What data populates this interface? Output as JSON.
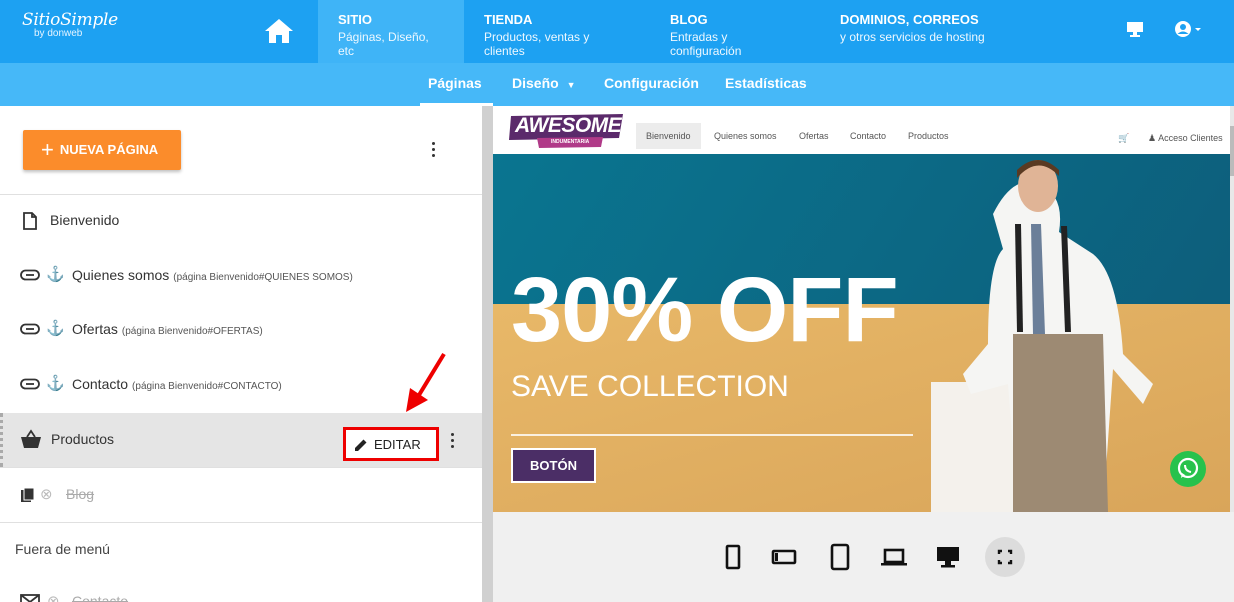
{
  "brand": {
    "name": "SitioSimple",
    "by": "by donweb"
  },
  "topnav": [
    {
      "title": "SITIO",
      "subtitle": "Páginas, Diseño, etc"
    },
    {
      "title": "TIENDA",
      "subtitle": "Productos, ventas y clientes"
    },
    {
      "title": "BLOG",
      "subtitle": "Entradas y configuración"
    },
    {
      "title": "DOMINIOS, CORREOS",
      "subtitle": "y otros servicios de hosting"
    }
  ],
  "subnav": [
    "Páginas",
    "Diseño",
    "Configuración",
    "Estadísticas"
  ],
  "left": {
    "new_page_label": "NUEVA PÁGINA",
    "pages": [
      {
        "label": "Bienvenido",
        "hint": ""
      },
      {
        "label": "Quienes somos",
        "hint": "(página Bienvenido#QUIENES SOMOS)"
      },
      {
        "label": "Ofertas",
        "hint": "(página Bienvenido#OFERTAS)"
      },
      {
        "label": "Contacto",
        "hint": "(página Bienvenido#CONTACTO)"
      },
      {
        "label": "Productos",
        "hint": ""
      },
      {
        "label": "Blog",
        "hint": ""
      }
    ],
    "edit_label": "EDITAR",
    "section_out_of_menu": "Fuera de menú",
    "hidden_contact": "Contacto"
  },
  "preview": {
    "logo_text": "AWESOME",
    "logo_sub": "INDUMENTARIA",
    "menu": [
      "Bienvenido",
      "Quienes somos",
      "Ofertas",
      "Contacto",
      "Productos"
    ],
    "client_access": "Acceso Clientes",
    "hero_title": "30% OFF",
    "hero_subtitle": "SAVE COLLECTION",
    "hero_button": "BOTÓN"
  },
  "colors": {
    "topbar": "#1da1f2",
    "subbar": "#46b8f8",
    "accent_orange": "#fb8c2b",
    "highlight_red": "#e00000",
    "whatsapp": "#27c24c"
  }
}
